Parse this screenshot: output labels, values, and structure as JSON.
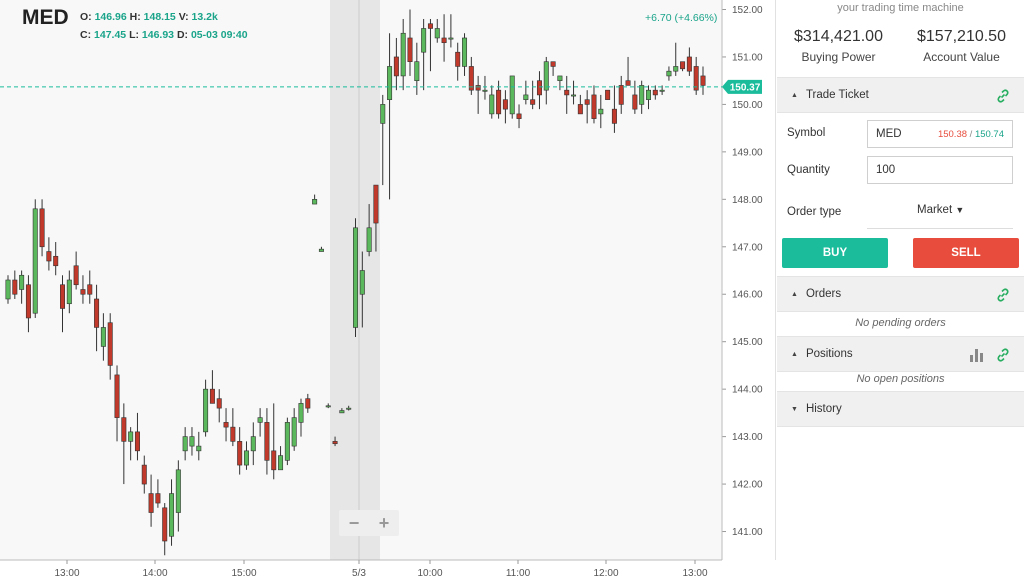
{
  "chart": {
    "symbol": "MED",
    "ohlc": {
      "o_label": "O:",
      "o": "146.96",
      "h_label": "H:",
      "h": "148.15",
      "v_label": "V:",
      "v": "13.2k",
      "c_label": "C:",
      "c": "147.45",
      "l_label": "L:",
      "l": "146.93",
      "d_label": "D:",
      "d": "05-03 09:40"
    },
    "change": "+6.70 (+4.66%)",
    "last_price_tag": "150.37",
    "zoom_out": "−",
    "zoom_in": "+",
    "colors": {
      "up": "#5cb85c",
      "down": "#c0392b",
      "accent": "#1abc9c"
    }
  },
  "chart_data": {
    "type": "candlestick",
    "y_ticks": [
      "152.00",
      "151.00",
      "150.00",
      "149.00",
      "148.00",
      "147.00",
      "146.00",
      "145.00",
      "144.00",
      "143.00",
      "142.00",
      "141.00"
    ],
    "x_ticks": [
      "13:00",
      "14:00",
      "15:00",
      "5/3",
      "10:00",
      "11:00",
      "12:00",
      "13:00"
    ],
    "ylim": [
      140.4,
      152.2
    ],
    "last_price": 150.37,
    "candles": [
      [
        145.9,
        146.4,
        145.8,
        146.3
      ],
      [
        146.3,
        146.5,
        145.9,
        146.0
      ],
      [
        146.1,
        146.5,
        145.8,
        146.4
      ],
      [
        146.2,
        146.4,
        145.2,
        145.5
      ],
      [
        145.6,
        148.0,
        145.5,
        147.8
      ],
      [
        147.8,
        148.0,
        146.8,
        147.0
      ],
      [
        146.9,
        147.2,
        146.5,
        146.7
      ],
      [
        146.8,
        147.1,
        146.4,
        146.6
      ],
      [
        146.2,
        146.4,
        145.2,
        145.7
      ],
      [
        145.8,
        146.5,
        145.6,
        146.3
      ],
      [
        146.6,
        146.9,
        146.1,
        146.2
      ],
      [
        146.1,
        146.4,
        145.8,
        146.0
      ],
      [
        146.2,
        146.5,
        145.8,
        146.0
      ],
      [
        145.9,
        146.2,
        144.8,
        145.3
      ],
      [
        144.9,
        145.6,
        144.6,
        145.3
      ],
      [
        145.4,
        145.6,
        144.2,
        144.5
      ],
      [
        144.3,
        144.5,
        142.9,
        143.4
      ],
      [
        143.4,
        143.7,
        142.0,
        142.9
      ],
      [
        142.9,
        143.2,
        142.5,
        143.1
      ],
      [
        143.1,
        143.5,
        142.5,
        142.7
      ],
      [
        142.4,
        142.6,
        141.8,
        142.0
      ],
      [
        141.8,
        142.2,
        141.1,
        141.4
      ],
      [
        141.8,
        142.1,
        141.5,
        141.6
      ],
      [
        141.5,
        141.6,
        140.5,
        140.8
      ],
      [
        140.9,
        142.1,
        140.7,
        141.8
      ],
      [
        141.4,
        142.5,
        141.0,
        142.3
      ],
      [
        142.7,
        143.2,
        142.5,
        143.0
      ],
      [
        142.8,
        143.2,
        142.6,
        143.0
      ],
      [
        142.7,
        143.1,
        142.5,
        142.8
      ],
      [
        143.1,
        144.2,
        143.0,
        144.0
      ],
      [
        144.0,
        144.4,
        143.7,
        143.7
      ],
      [
        143.8,
        144.0,
        143.3,
        143.6
      ],
      [
        143.3,
        143.6,
        142.9,
        143.2
      ],
      [
        143.2,
        143.6,
        142.8,
        142.9
      ],
      [
        142.9,
        143.2,
        142.2,
        142.4
      ],
      [
        142.4,
        142.9,
        142.3,
        142.7
      ],
      [
        142.7,
        143.3,
        142.4,
        143.0
      ],
      [
        143.3,
        143.6,
        143.0,
        143.4
      ],
      [
        143.3,
        143.6,
        142.2,
        142.5
      ],
      [
        142.7,
        143.7,
        142.1,
        142.3
      ],
      [
        142.3,
        142.8,
        142.3,
        142.6
      ],
      [
        142.5,
        143.4,
        142.4,
        143.3
      ],
      [
        142.8,
        143.6,
        142.7,
        143.4
      ],
      [
        143.3,
        143.8,
        143.0,
        143.7
      ],
      [
        143.8,
        143.9,
        143.5,
        143.6
      ],
      [
        147.9,
        148.1,
        147.9,
        148.0
      ],
      [
        146.9,
        147.0,
        146.9,
        146.95
      ],
      [
        143.65,
        143.7,
        143.6,
        143.65
      ],
      [
        142.9,
        143.0,
        142.8,
        142.85
      ],
      [
        143.5,
        143.6,
        143.5,
        143.55
      ],
      [
        143.6,
        143.65,
        143.55,
        143.6
      ],
      [
        145.3,
        147.6,
        145.1,
        147.4
      ],
      [
        146.0,
        146.9,
        145.3,
        146.5
      ],
      [
        146.9,
        147.9,
        146.8,
        147.4
      ],
      [
        148.3,
        148.3,
        146.9,
        147.5
      ],
      [
        149.6,
        150.2,
        148.3,
        150.0
      ],
      [
        150.1,
        151.5,
        148.0,
        150.8
      ],
      [
        151.0,
        151.4,
        150.3,
        150.6
      ],
      [
        150.6,
        151.8,
        150.3,
        151.5
      ],
      [
        151.4,
        152.0,
        150.6,
        150.9
      ],
      [
        150.5,
        151.3,
        150.2,
        150.9
      ],
      [
        151.1,
        151.8,
        150.3,
        151.6
      ],
      [
        151.7,
        151.8,
        150.7,
        151.6
      ],
      [
        151.4,
        151.8,
        151.3,
        151.6
      ],
      [
        151.4,
        151.9,
        150.9,
        151.3
      ],
      [
        151.4,
        151.9,
        151.2,
        151.4
      ],
      [
        151.1,
        151.3,
        150.5,
        150.8
      ],
      [
        150.8,
        151.5,
        150.6,
        151.4
      ],
      [
        150.8,
        151.0,
        150.2,
        150.3
      ],
      [
        150.4,
        150.6,
        149.8,
        150.3
      ],
      [
        150.3,
        150.6,
        150.1,
        150.3
      ],
      [
        149.8,
        150.4,
        149.7,
        150.2
      ],
      [
        150.3,
        150.5,
        149.7,
        149.8
      ],
      [
        150.1,
        150.3,
        149.6,
        149.9
      ],
      [
        149.8,
        150.6,
        149.7,
        150.6
      ],
      [
        149.8,
        150.0,
        149.5,
        149.7
      ],
      [
        150.1,
        150.5,
        150.0,
        150.2
      ],
      [
        150.1,
        150.5,
        149.9,
        150.0
      ],
      [
        150.5,
        150.7,
        149.9,
        150.2
      ],
      [
        150.3,
        151.0,
        150.0,
        150.9
      ],
      [
        150.9,
        150.9,
        150.6,
        150.8
      ],
      [
        150.5,
        150.5,
        150.3,
        150.6
      ],
      [
        150.3,
        150.6,
        149.8,
        150.2
      ],
      [
        150.2,
        150.5,
        150.0,
        150.2
      ],
      [
        150.0,
        150.2,
        149.8,
        149.8
      ],
      [
        150.1,
        150.3,
        149.6,
        150.0
      ],
      [
        150.2,
        150.4,
        149.6,
        149.7
      ],
      [
        149.8,
        150.2,
        149.5,
        149.9
      ],
      [
        150.3,
        150.3,
        150.1,
        150.1
      ],
      [
        149.9,
        150.4,
        149.4,
        149.6
      ],
      [
        150.4,
        150.6,
        149.8,
        150.0
      ],
      [
        150.5,
        151.0,
        150.4,
        150.4
      ],
      [
        150.2,
        150.5,
        149.8,
        149.9
      ],
      [
        150.0,
        150.5,
        149.8,
        150.4
      ],
      [
        150.1,
        150.4,
        149.9,
        150.3
      ],
      [
        150.3,
        150.4,
        150.1,
        150.2
      ],
      [
        150.3,
        150.4,
        150.2,
        150.3
      ],
      [
        150.6,
        150.8,
        150.5,
        150.7
      ],
      [
        150.7,
        151.3,
        150.6,
        150.8
      ],
      [
        150.9,
        150.9,
        150.7,
        150.75
      ],
      [
        151.0,
        151.2,
        150.6,
        150.7
      ],
      [
        150.8,
        151.0,
        150.2,
        150.3
      ],
      [
        150.6,
        150.8,
        150.2,
        150.4
      ]
    ]
  },
  "sidebar": {
    "tagline": "your trading time machine",
    "buying_power": "$314,421.00",
    "buying_power_label": "Buying Power",
    "account_value": "$157,210.50",
    "account_value_label": "Account Value",
    "trade_ticket": {
      "title": "Trade Ticket",
      "symbol_label": "Symbol",
      "symbol_value": "MED",
      "bid": "150.38",
      "ask": "150.74",
      "quote_sep": " / ",
      "quantity_label": "Quantity",
      "quantity_value": "100",
      "order_type_label": "Order type",
      "order_type_value": "Market",
      "buy_label": "BUY",
      "sell_label": "SELL"
    },
    "orders": {
      "title": "Orders",
      "empty": "No pending orders"
    },
    "positions": {
      "title": "Positions",
      "empty": "No open positions"
    },
    "history": {
      "title": "History"
    }
  }
}
